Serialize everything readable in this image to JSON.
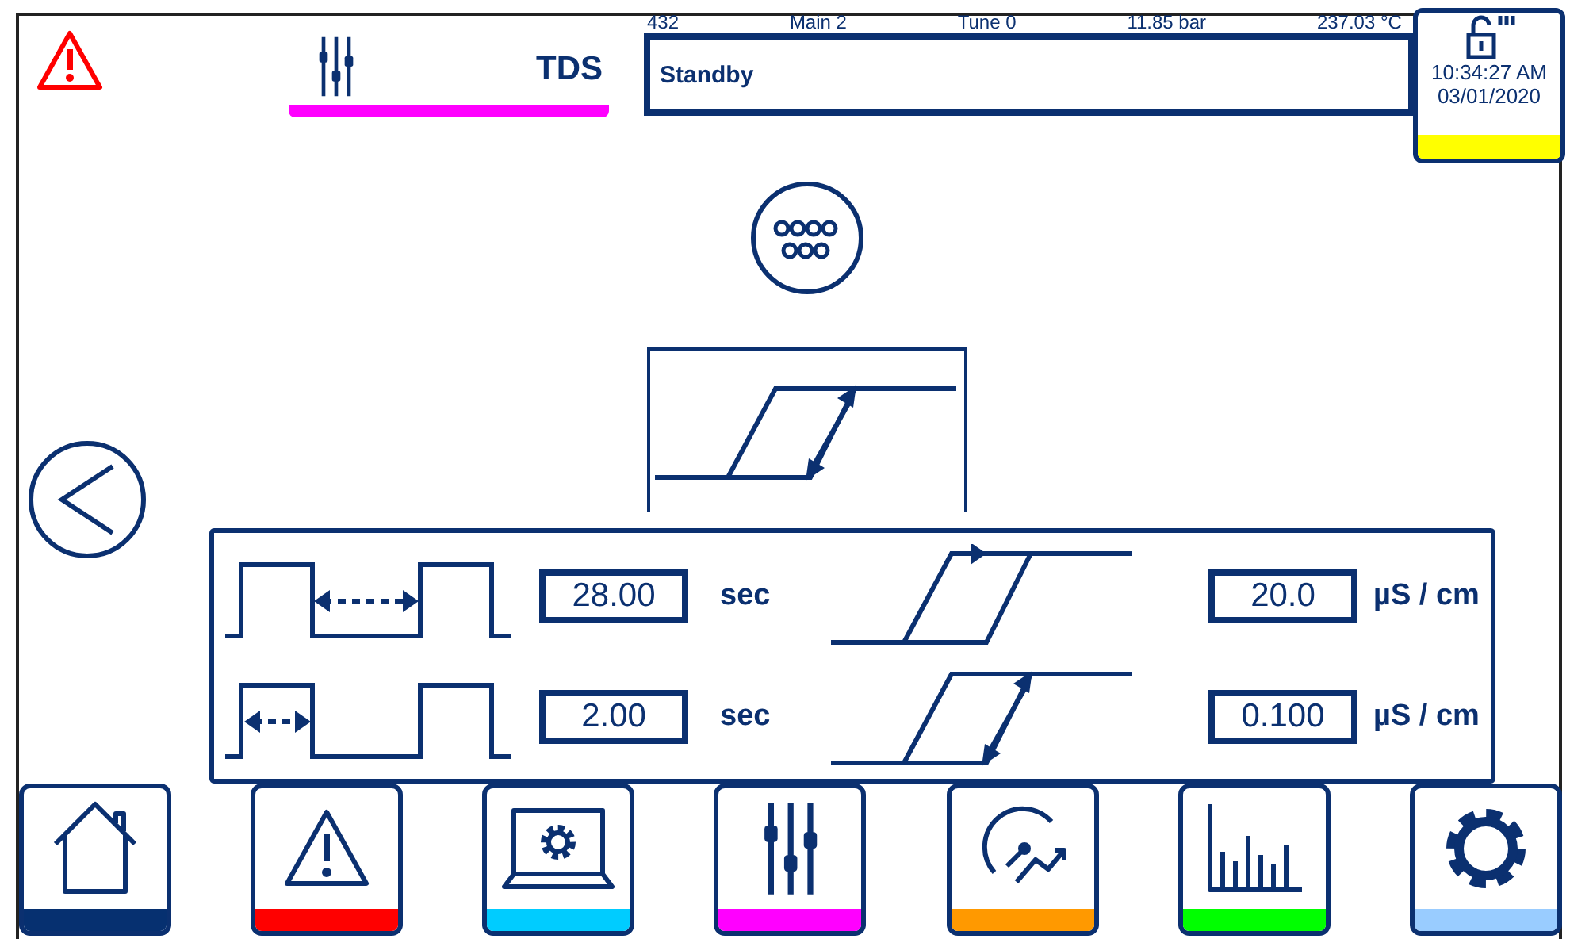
{
  "header": {
    "tab_label": "TDS",
    "status_readings": [
      "432",
      "Main 2",
      "Tune 0",
      "11.85  bar",
      "237.03 °C"
    ],
    "status_message": "Standby",
    "time": "10:34:27 AM",
    "date": "03/01/2020"
  },
  "parameters": [
    {
      "kind": "cycle-interval",
      "value": "28.00",
      "unit": "sec"
    },
    {
      "kind": "hysteresis-setpoint",
      "value": "20.0",
      "unit": "µS / cm"
    },
    {
      "kind": "cycle-duration",
      "value": "2.00",
      "unit": "sec"
    },
    {
      "kind": "hysteresis-band",
      "value": "0.100",
      "unit": "µS / cm"
    }
  ],
  "nav": [
    {
      "kind": "home",
      "color": "#063070"
    },
    {
      "kind": "alarm",
      "color": "#ff0000"
    },
    {
      "kind": "laptop",
      "color": "#00ccff"
    },
    {
      "kind": "sliders",
      "color": "#ff00ff"
    },
    {
      "kind": "gauge",
      "color": "#ff9900"
    },
    {
      "kind": "chart",
      "color": "#00ff00"
    },
    {
      "kind": "gear",
      "color": "#99ccff"
    }
  ]
}
